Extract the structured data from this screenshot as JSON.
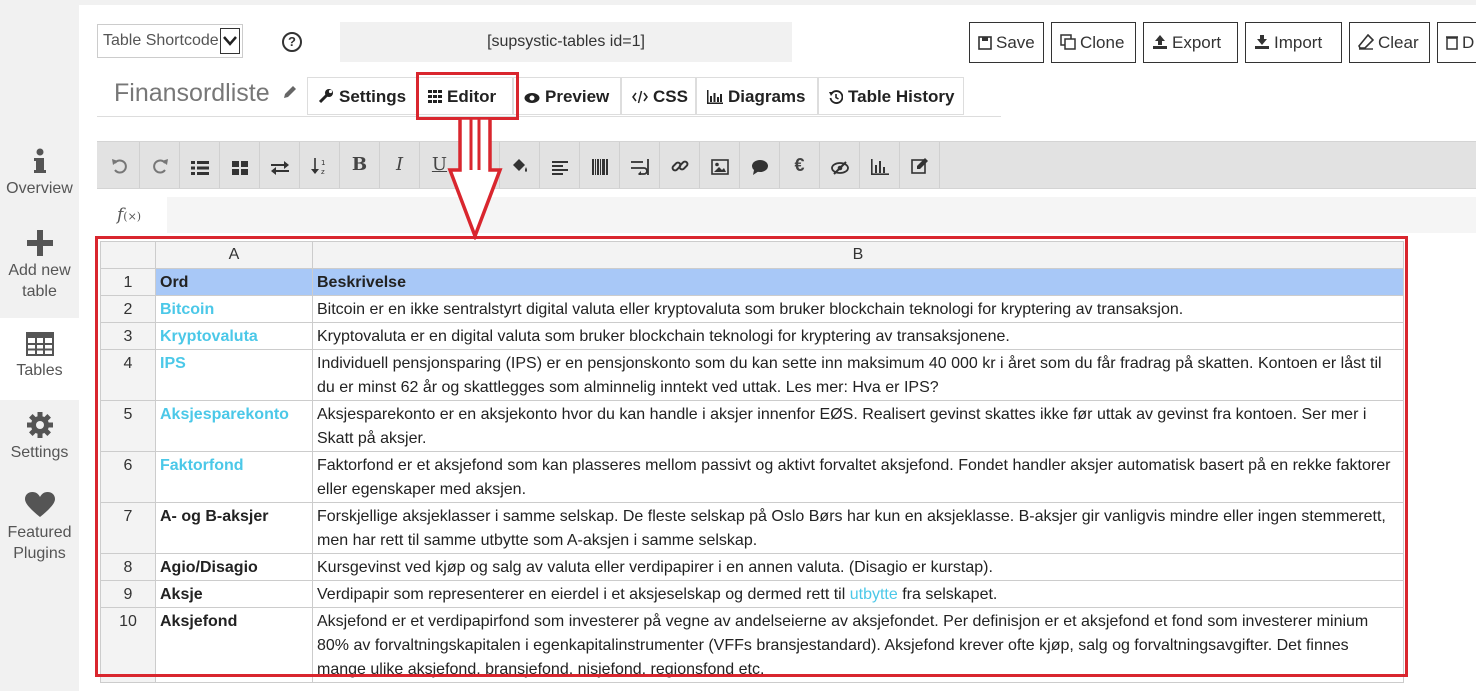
{
  "sidebar": {
    "items": [
      {
        "label": "Overview",
        "icon": "info-icon"
      },
      {
        "label": "Add new table",
        "icon": "plus-icon"
      },
      {
        "label": "Tables",
        "icon": "table-icon"
      },
      {
        "label": "Settings",
        "icon": "gear-icon"
      },
      {
        "label": "Featured Plugins",
        "icon": "heart-icon"
      }
    ]
  },
  "header": {
    "select_value": "Table Shortcode",
    "shortcode": "[supsystic-tables id=1]",
    "buttons": {
      "save": "Save",
      "clone": "Clone",
      "export": "Export",
      "import": "Import",
      "clear": "Clear",
      "delete": "D"
    }
  },
  "table_title": "Finansordliste",
  "tabs": {
    "settings": "Settings",
    "editor": "Editor",
    "preview": "Preview",
    "css": "CSS",
    "diagrams": "Diagrams",
    "history": "Table History"
  },
  "formula": {
    "label": "f",
    "sub": "(×)"
  },
  "grid": {
    "col_a": "A",
    "col_b": "B",
    "rows": [
      {
        "n": "1",
        "a": "Ord",
        "b": "Beskrivelse"
      },
      {
        "n": "2",
        "a": "Bitcoin",
        "b": "Bitcoin er en ikke sentralstyrt digital valuta eller kryptovaluta som bruker blockchain teknologi for kryptering av transaksjon."
      },
      {
        "n": "3",
        "a": "Kryptovaluta",
        "b": "Kryptovaluta er en digital valuta som bruker blockchain teknologi for kryptering av transaksjonene."
      },
      {
        "n": "4",
        "a": "IPS",
        "b": "Individuell pensjonsparing (IPS) er en pensjonskonto som du kan sette inn maksimum 40 000 kr i året som du får fradrag på skatten. Kontoen er låst til du er minst 62 år og skattlegges som alminnelig inntekt ved uttak. Les mer: Hva er IPS?"
      },
      {
        "n": "5",
        "a": "Aksjesparekonto",
        "b": "Aksjesparekonto er en aksjekonto hvor du kan handle i aksjer innenfor EØS. Realisert gevinst skattes ikke før uttak av gevinst fra kontoen. Ser mer i Skatt på aksjer."
      },
      {
        "n": "6",
        "a": "Faktorfond",
        "b": "Faktorfond er et aksjefond som kan plasseres mellom passivt og aktivt forvaltet aksjefond. Fondet handler aksjer automatisk basert på en rekke faktorer eller egenskaper med aksjen."
      },
      {
        "n": "7",
        "a": "A- og B-aksjer",
        "b": "Forskjellige aksjeklasser i samme selskap. De fleste selskap på Oslo Børs har kun en aksjeklasse. B-aksjer gir vanligvis mindre eller ingen stemmerett, men har rett til samme utbytte som A-aksjen i samme selskap."
      },
      {
        "n": "8",
        "a": "Agio/Disagio",
        "b": "Kursgevinst ved kjøp og salg av valuta eller verdipapirer i en annen valuta. (Disagio er kurstap)."
      },
      {
        "n": "9",
        "a": "Aksje",
        "b_pre": "Verdipapir som representerer en eierdel i et aksjeselskap og dermed rett til ",
        "b_link": "utbytte",
        "b_post": " fra selskapet."
      },
      {
        "n": "10",
        "a": "Aksjefond",
        "b": "Aksjefond er et verdipapirfond som investerer på vegne av andelseierne av aksjefondet. Per definisjon er et aksjefond et fond som investerer minium 80% av forvaltningskapitalen i egenkapitalinstrumenter (VFFs bransjestandard). Aksjefond krever ofte kjøp, salg og forvaltningsavgifter. Det finnes mange ulike aksjefond, bransjefond, nisjefond, regionsfond etc."
      }
    ]
  },
  "colors": {
    "accent_red": "#d9262e",
    "header_row": "#a8c8f7",
    "link": "#4bc8e8"
  }
}
